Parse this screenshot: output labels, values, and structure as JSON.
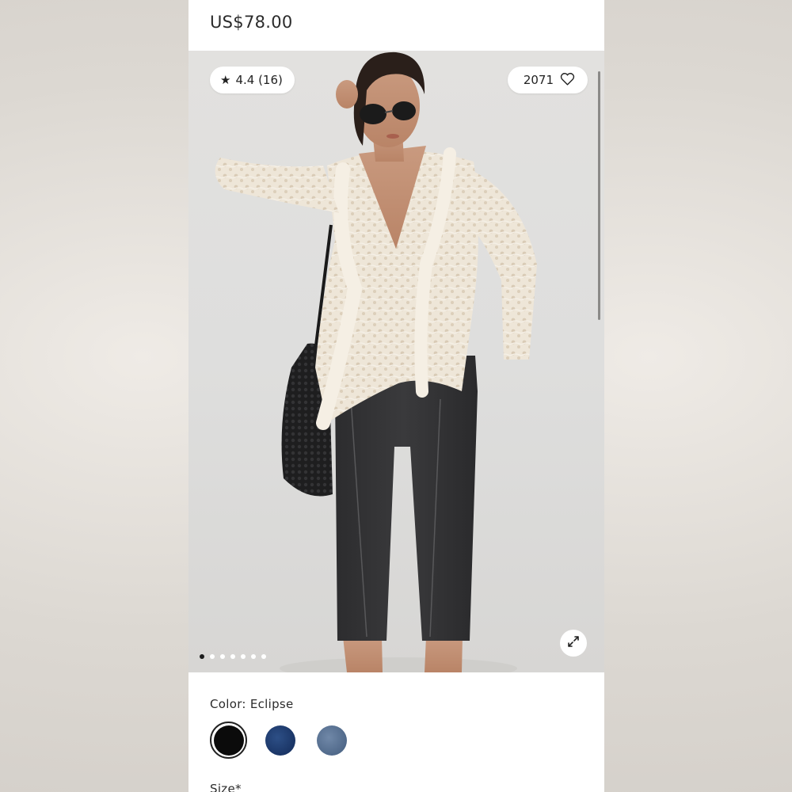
{
  "product": {
    "price": "US$78.00"
  },
  "gallery": {
    "rating_star": "★",
    "rating_text": "4.4 (16)",
    "likes_count": "2071",
    "slide_count": 7,
    "active_slide": 1
  },
  "color": {
    "label": "Color: Eclipse",
    "swatches": [
      {
        "name": "Eclipse",
        "hex": "#0b0b0b",
        "selected": true
      },
      {
        "name": "Navy",
        "hex": "#1f3a6b",
        "selected": false
      },
      {
        "name": "Denim",
        "hex": "#5b7394",
        "selected": false
      }
    ]
  },
  "size": {
    "label": "Size*"
  },
  "icons": {
    "rating": "star-icon",
    "likes": "heart-icon",
    "expand": "expand-icon"
  }
}
